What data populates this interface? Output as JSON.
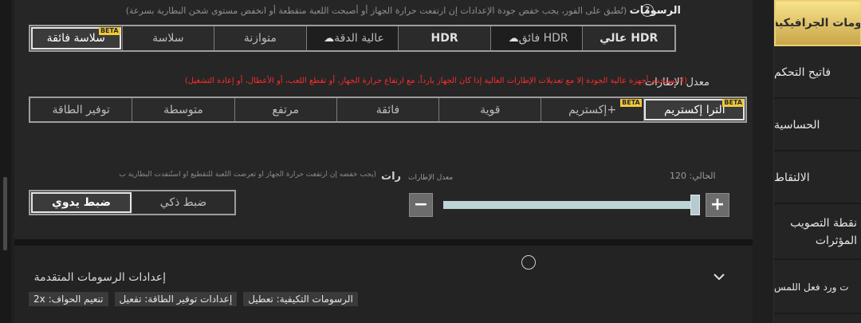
{
  "header": {
    "title": "الرسومات",
    "note": "(تُطبق على الفور، يجب خفض جودة الإعدادات إن ارتفعت حرارة الجهاز أو أصبحت اللعبة متقطعة أو انخفض مستوى شحن البطارية بسرعة)"
  },
  "graphics": {
    "options": [
      {
        "label": "عالي HDR",
        "beta": ""
      },
      {
        "label": "فائق HDR",
        "beta": ""
      },
      {
        "label": "HDR",
        "beta": ""
      },
      {
        "label": "عالية الدقة",
        "beta": ""
      },
      {
        "label": "متوازنة",
        "beta": ""
      },
      {
        "label": "سلاسة",
        "beta": ""
      },
      {
        "label": "سلاسة فائقة",
        "beta": "BETA"
      }
    ],
    "selected": "سلاسة فائقة"
  },
  "frame_rate": {
    "title": "معدل الإطارات",
    "warning": "(لا تستخدم أجهزة عالية الجودة إلا مع تعديلات الإطارات العالية إذا كان الجهاز بارداً، مع ارتفاع حرارة الجهاز، أو تقطع اللعب، أو الأعطال، أو إعادة التشغيل)",
    "options": [
      {
        "label": "ألترا إكستريم",
        "beta": "BETA"
      },
      {
        "label": "إكستريم+",
        "beta": "BETA"
      },
      {
        "label": "قوية",
        "beta": ""
      },
      {
        "label": "فائقة",
        "beta": ""
      },
      {
        "label": "مرتفع",
        "beta": ""
      },
      {
        "label": "متوسطة",
        "beta": ""
      },
      {
        "label": "توفير الطاقة",
        "beta": ""
      }
    ],
    "selected": "ألترا إكستريم"
  },
  "fps_limit": {
    "label": "رات",
    "note": "(يجب خفضه إن ارتفعت حرارة الجهاز أو تعرضت اللعبة للتقطيع أو استُنفدت البطارية ب",
    "slider_title": "معدل الإطارات",
    "current_label": "الحالي:",
    "current_value": "120",
    "slider_fraction": 1.0,
    "mode_manual": "ضبط يدوي",
    "mode_smart": "ضبط ذكي",
    "mode_selected": "ضبط يدوي"
  },
  "advanced": {
    "title": "إعدادات الرسومات المتقدمة",
    "tags": [
      "الرسومات التكيفية: تعطيل",
      "إعدادات توفير الطاقة: تفعيل",
      "تنعيم الحواف: 2x"
    ]
  },
  "sidebar": {
    "items": [
      {
        "label": "رومات الجرافيكية",
        "active": true
      },
      {
        "label": "فاتيح التحكم",
        "active": false
      },
      {
        "label": "الحساسية",
        "active": false
      },
      {
        "label": "الالتقاط",
        "active": false
      },
      {
        "label": "نقطة التصويب المؤثرات",
        "active": false
      },
      {
        "label": "ت ورد فعل اللمس",
        "active": false
      }
    ]
  },
  "colors": {
    "accent_gold": "#f0c93a",
    "warning_red": "#ff2b2b",
    "active_tab": "#e9cd6e"
  }
}
